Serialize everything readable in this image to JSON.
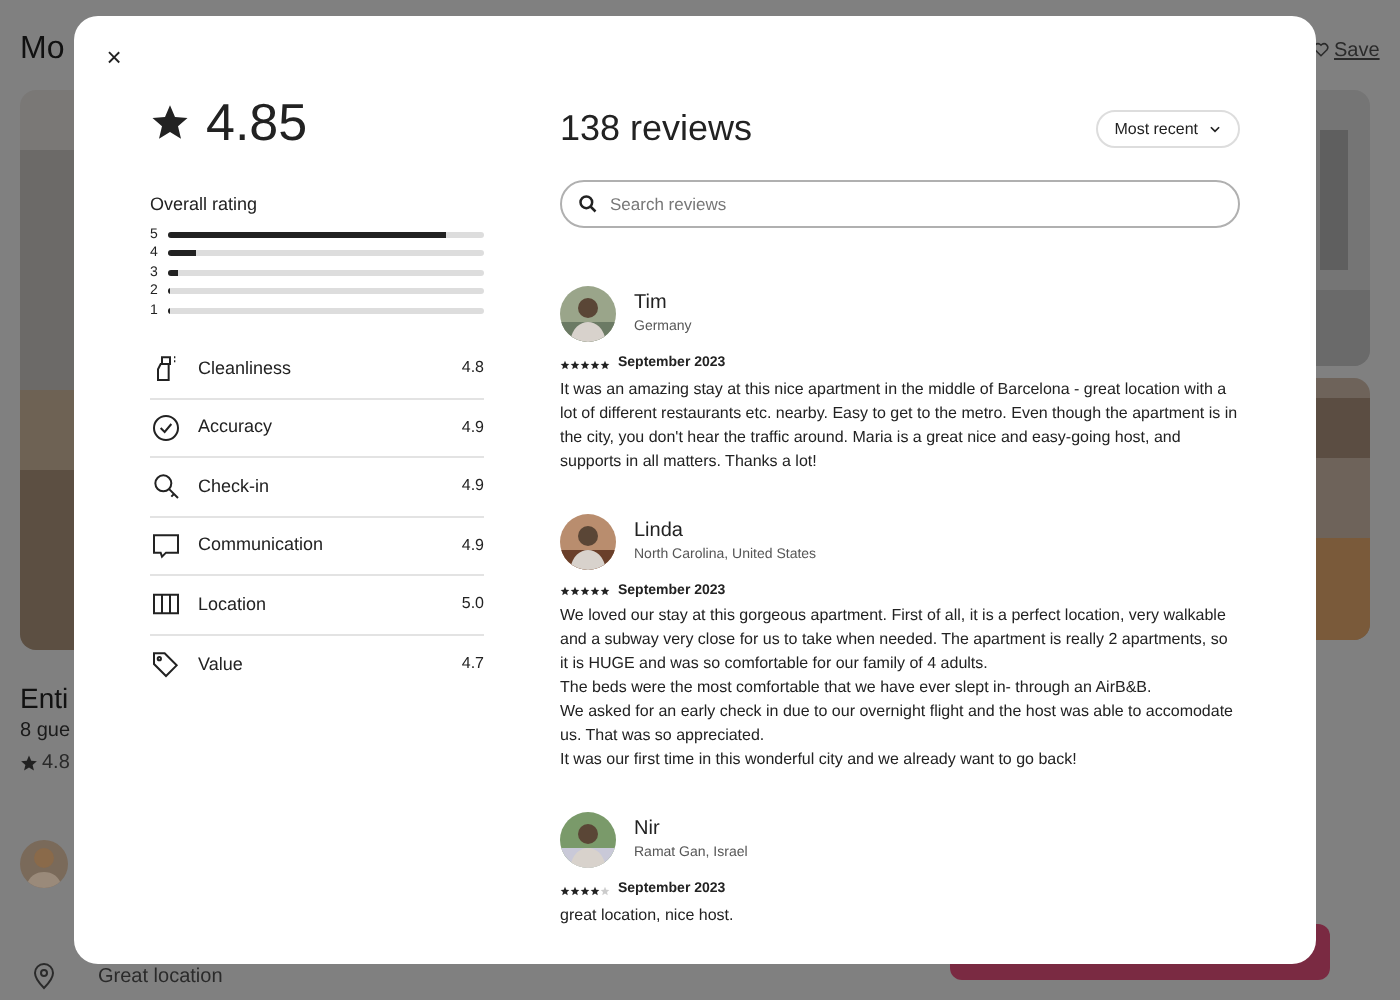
{
  "background_page": {
    "title": "Mo",
    "save_link": "Save",
    "listing_title": "Enti",
    "listing_subtitle": "8 gue",
    "listing_rating": "4.8",
    "highlight": "Great location"
  },
  "modal": {
    "close": "×",
    "rating": "4.85",
    "overall_label": "Overall rating",
    "distribution": [
      {
        "label": "5",
        "level": 0.88
      },
      {
        "label": "4",
        "level": 0.09
      },
      {
        "label": "3",
        "level": 0.03
      },
      {
        "label": "2",
        "level": 0
      },
      {
        "label": "1",
        "level": 0
      }
    ],
    "categories": [
      {
        "kind": "spray",
        "name": "Cleanliness",
        "score": "4.8"
      },
      {
        "kind": "check",
        "name": "Accuracy",
        "score": "4.9"
      },
      {
        "kind": "key",
        "name": "Check-in",
        "score": "4.9"
      },
      {
        "kind": "chat",
        "name": "Communication",
        "score": "4.9"
      },
      {
        "kind": "map",
        "name": "Location",
        "score": "5.0"
      },
      {
        "kind": "tag",
        "name": "Value",
        "score": "4.7"
      }
    ],
    "reviews_title": "138 reviews",
    "sort": "Most recent",
    "search": {
      "placeholder": "Search reviews"
    },
    "reviews": [
      {
        "name": "Tim",
        "location": "Germany",
        "stars": 5,
        "date": "September 2023",
        "paragraphs": [
          "It was an amazing stay at this nice apartment in the middle of Barcelona - great location with a lot of different restaurants etc. nearby. Easy to get to the metro. Even though the apartment is in the city, you don't hear the traffic around. Maria is a great nice and easy-going host, and supports in all matters. Thanks a lot!"
        ]
      },
      {
        "name": "Linda",
        "location": "North Carolina, United States",
        "stars": 5,
        "date": "September 2023",
        "paragraphs": [
          "We loved our stay at this gorgeous apartment. First of all, it is a perfect location, very walkable and a subway very close for us to take when needed. The apartment is really 2 apartments, so it is HUGE and was so comfortable for our family of 4 adults.",
          "The beds were the most comfortable that we have ever slept in- through an AirB&B.",
          "We asked for an early check in due to our overnight flight and the host was able to accomodate us. That was so appreciated.",
          "It was our first time in this wonderful city and we already want to go back!"
        ]
      },
      {
        "name": "Nir",
        "location": "Ramat Gan, Israel",
        "stars": 4,
        "date": "September 2023",
        "paragraphs": [
          "great location, nice host."
        ]
      }
    ]
  }
}
